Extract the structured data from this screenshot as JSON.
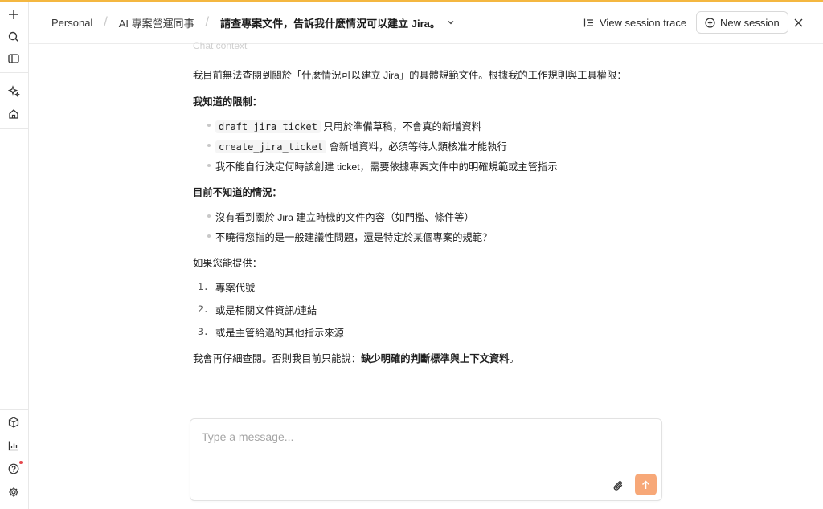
{
  "header": {
    "breadcrumbs": [
      "Personal",
      "AI 專案營運同事",
      "請查專案文件，告訴我什麼情況可以建立 Jira。"
    ],
    "view_trace_label": "View session trace",
    "new_session_label": "New session"
  },
  "chat": {
    "faded_label": "Chat context",
    "intro": "我目前無法查閱到關於「什麼情況可以建立 Jira」的具體規範文件。根據我的工作規則與工具權限：",
    "known_heading": "我知道的限制：",
    "known_items": [
      {
        "code": "draft_jira_ticket",
        "text": "只用於準備草稿，不會真的新增資料"
      },
      {
        "code": "create_jira_ticket",
        "text": "會新增資料，必須等待人類核准才能執行"
      },
      {
        "code": "",
        "text": "我不能自行決定何時該創建 ticket，需要依據專案文件中的明確規範或主管指示"
      }
    ],
    "unknown_heading": "目前不知道的情況：",
    "unknown_items": [
      "沒有看到關於 Jira 建立時機的文件內容（如門檻、條件等）",
      "不曉得您指的是一般建議性問題，還是特定於某個專案的規範？"
    ],
    "provide_intro": "如果您能提供：",
    "provide_items": [
      {
        "num": "1.",
        "text": "專案代號"
      },
      {
        "num": "2.",
        "text": "或是相關文件資訊/連結"
      },
      {
        "num": "3.",
        "text": "或是主管給過的其他指示來源"
      }
    ],
    "closing_prefix": "我會再仔細查閱。否則我目前只能說：",
    "closing_bold": "缺少明確的判斷標準與上下文資料",
    "closing_suffix": "。"
  },
  "composer": {
    "placeholder": "Type a message..."
  },
  "colors": {
    "accent_stripe": "#f4b740",
    "send_button": "#f7a878",
    "notification_dot": "#e5484d"
  }
}
